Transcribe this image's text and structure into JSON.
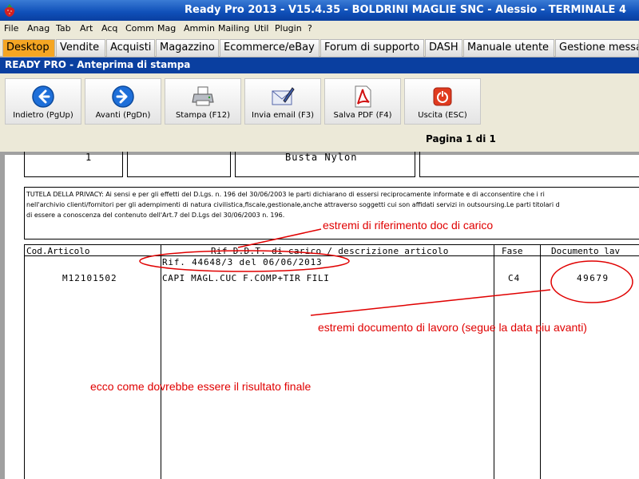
{
  "window": {
    "title": "Ready Pro 2013 - V15.4.35 - BOLDRINI MAGLIE SNC - Alessio - TERMINALE 4"
  },
  "menu": [
    "File",
    "Anag",
    "Tab",
    "Art",
    "Acq",
    "Comm",
    "Mag",
    "Ammin",
    "Mailing",
    "Util",
    "Plugin",
    "?"
  ],
  "tabs": [
    "Desktop",
    "Vendite",
    "Acquisti",
    "Magazzino",
    "Ecommerce/eBay",
    "Forum di supporto",
    "DASH",
    "Manuale utente",
    "Gestione messa"
  ],
  "section_title": "READY PRO - Anteprima di stampa",
  "toolbar": {
    "back": "Indietro (PgUp)",
    "forward": "Avanti (PgDn)",
    "print": "Stampa (F12)",
    "email": "Invia email (F3)",
    "pdf": "Salva PDF (F4)",
    "exit": "Uscita (ESC)"
  },
  "page_info": "Pagina 1 di 1",
  "document": {
    "top_row": {
      "qty": "1",
      "description": "Busta Nylon"
    },
    "privacy_lines": [
      "TUTELA DELLA PRIVACY: Ai sensi e per gli effetti del D.Lgs. n. 196 del 30/06/2003 le parti dichiarano di essersi reciprocamente informate e di acconsentire che i ri",
      "nell'archivio clienti/fornitori per gli adempimenti di natura civilistica,fiscale,gestionale,anche attraverso soggetti cui son affidati servizi in outsoursing.Le parti titolari d",
      "di essere a conoscenza del contenuto dell'Art.7 del D.Lgs del 30/06/2003 n. 196."
    ],
    "table": {
      "headers": {
        "code": "Cod.Articolo",
        "ref": "Rif D.D.T. di carico / descrizione articolo",
        "phase": "Fase",
        "doc": "Documento lav"
      },
      "ref_line": "Rif. 44648/3 del 06/06/2013",
      "row": {
        "code": "M12101502",
        "description": "CAPI MAGL.CUC F.COMP+TIR FILI",
        "phase": "C4",
        "doc": "49679"
      }
    }
  },
  "annotations": {
    "note1": "estremi di riferimento doc di carico",
    "note2": "estremi documento di lavoro (segue la data piu avanti)",
    "note3": "ecco come dovrebbe essere il risultato finale"
  },
  "colors": {
    "annotation": "#e00000",
    "active_tab": "#f5a623",
    "section_bar": "#0a3fa0"
  }
}
